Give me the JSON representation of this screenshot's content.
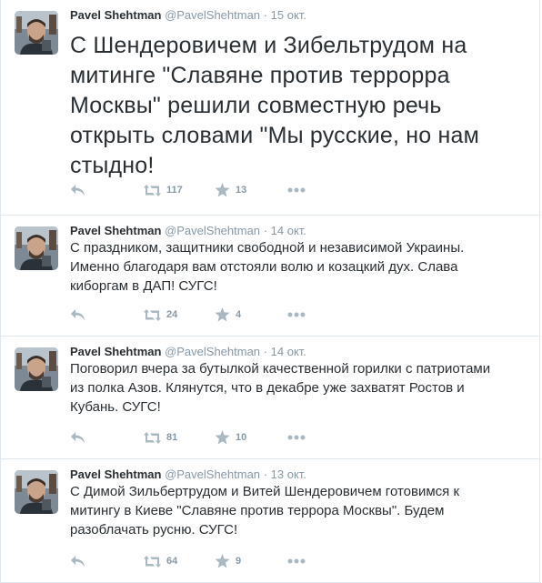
{
  "colors": {
    "text": "#292f33",
    "muted": "#8899a6",
    "icon": "#aab8c2",
    "border": "#e1e8ed"
  },
  "tweets": [
    {
      "fullname": "Pavel Shehtman",
      "username": "@PavelShehtman",
      "dot": "·",
      "date": "15 окт.",
      "text": "С Шендеровичем и Зибельтрудом на\nмитинге \"Славяне против террорра\nМосквы\" решили совместную речь\nоткрыть словами \"Мы русские, но нам\nстыдно!",
      "retweets": "117",
      "favorites": "13",
      "icons": {
        "reply": "reply-icon",
        "retweet": "retweet-icon",
        "favorite": "star-icon",
        "more": "more-icon"
      }
    },
    {
      "fullname": "Pavel Shehtman",
      "username": "@PavelShehtman",
      "dot": "·",
      "date": "14 окт.",
      "text": "С праздником, защитники свободной и независимой Украины.\nИменно благодаря вам отстояли волю и козацкий дух. Слава\nкиборгам в ДАП! СУГС!",
      "retweets": "24",
      "favorites": "4",
      "icons": {
        "reply": "reply-icon",
        "retweet": "retweet-icon",
        "favorite": "star-icon",
        "more": "more-icon"
      }
    },
    {
      "fullname": "Pavel Shehtman",
      "username": "@PavelShehtman",
      "dot": "·",
      "date": "14 окт.",
      "text": "Поговорил вчера за бутылкой качественной горилки с патриотами\nиз полка Азов. Клянутся, что в декабре уже захватят Ростов и\nКубань. СУГС!",
      "retweets": "81",
      "favorites": "10",
      "icons": {
        "reply": "reply-icon",
        "retweet": "retweet-icon",
        "favorite": "star-icon",
        "more": "more-icon"
      }
    },
    {
      "fullname": "Pavel Shehtman",
      "username": "@PavelShehtman",
      "dot": "·",
      "date": "13 окт.",
      "text": "С Димой Зильбертрудом и Витей Шендеровичем готовимся к\nмитингу в Киеве \"Славяне против террора Москвы\". Будем\nразоблачать русню. СУГС!",
      "retweets": "64",
      "favorites": "9",
      "icons": {
        "reply": "reply-icon",
        "retweet": "retweet-icon",
        "favorite": "star-icon",
        "more": "more-icon"
      }
    }
  ]
}
